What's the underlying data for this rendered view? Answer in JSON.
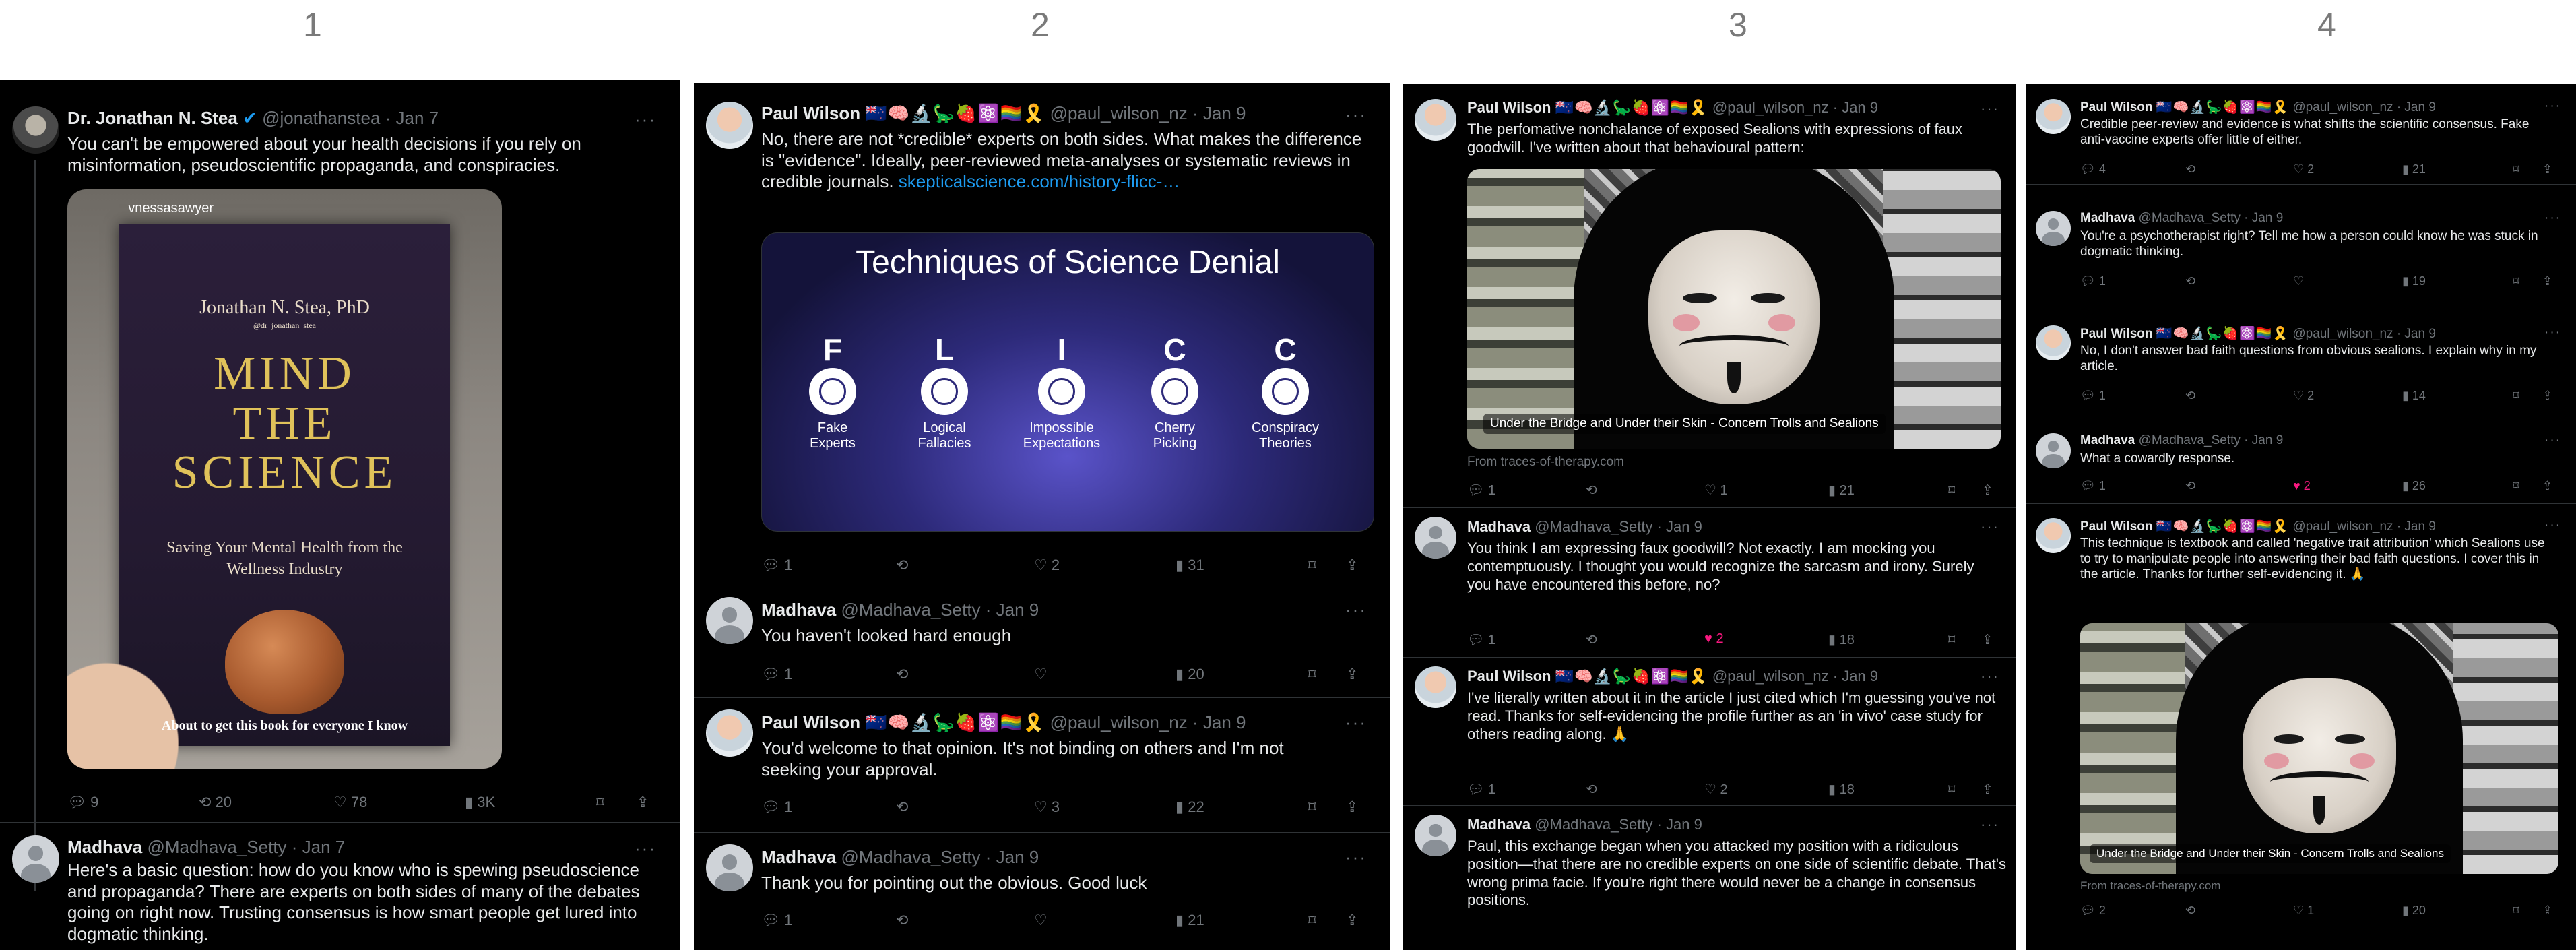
{
  "panel_numbers": [
    "1",
    "2",
    "3",
    "4"
  ],
  "icons": {
    "reply": "reply-icon",
    "retweet": "retweet-icon",
    "like": "heart-icon",
    "views": "views-icon",
    "bookmark": "bookmark-icon",
    "share": "share-icon",
    "more": "more-icon",
    "verified": "verified-icon"
  },
  "colors": {
    "background": "#000000",
    "link": "#1d9bf0",
    "muted": "#71767b",
    "like_active": "#f91880"
  },
  "paul_emojis": "🇳🇿🧠🔬🦕🍓⚛️🏳️‍🌈🎗️",
  "panel1": {
    "tweet1": {
      "name": "Dr. Jonathan N. Stea",
      "handle": "@jonathanstea · Jan 7",
      "text": "You can't be empowered about your health decisions if you rely on misinformation, pseudoscientific propaganda, and conspiracies.",
      "image": {
        "story_user": "vnessasawyer",
        "author": "Jonathan N. Stea, PhD",
        "author_handle": "@dr_jonathan_stea",
        "title_lines": [
          "MIND",
          "THE",
          "SCIENCE"
        ],
        "subtitle": "Saving Your Mental Health from the Wellness Industry",
        "caption": "About to get this book for everyone I know"
      },
      "replies": "9",
      "retweets": "20",
      "likes": "78",
      "views": "3K"
    },
    "tweet2": {
      "name": "Madhava",
      "handle": "@Madhava_Setty · Jan 7",
      "text": "Here's a basic question: how do you know who is spewing pseudoscience and propaganda? There are experts on both sides of many of the debates going on right now. Trusting consensus is how smart people get lured into dogmatic thinking."
    }
  },
  "panel2": {
    "tweet1": {
      "name": "Paul Wilson",
      "handle": "@paul_wilson_nz · Jan 9",
      "text": "No, there are not *credible* experts on both sides. What makes the difference is \"evidence\". Ideally, peer-reviewed meta-analyses or systematic reviews in credible journals.",
      "link": "skepticalscience.com/history-flicc-…",
      "card": {
        "title": "Techniques of Science Denial",
        "letters": [
          "F",
          "L",
          "I",
          "C",
          "C"
        ],
        "labels": [
          "Fake Experts",
          "Logical Fallacies",
          "Impossible Expectations",
          "Cherry Picking",
          "Conspiracy Theories"
        ]
      },
      "replies": "1",
      "retweets": "",
      "likes": "2",
      "views": "31"
    },
    "tweet2": {
      "name": "Madhava",
      "handle": "@Madhava_Setty · Jan 9",
      "text": "You haven't looked hard enough",
      "replies": "1",
      "likes": "",
      "views": "20"
    },
    "tweet3": {
      "name": "Paul Wilson",
      "handle": "@paul_wilson_nz · Jan 9",
      "text": "You'd welcome to that opinion. It's not binding on others and I'm not seeking your approval.",
      "replies": "1",
      "likes": "3",
      "views": "22"
    },
    "tweet4": {
      "name": "Madhava",
      "handle": "@Madhava_Setty · Jan 9",
      "text": "Thank you for pointing out the obvious. Good luck",
      "replies": "1",
      "likes": "",
      "views": "21"
    }
  },
  "panel3": {
    "tweet1": {
      "name": "Paul Wilson",
      "handle": "@paul_wilson_nz · Jan 9",
      "text": "The perfomative nonchalance of exposed Sealions with expressions of faux goodwill. I've written about that behavioural pattern:",
      "image_caption": "Under the Bridge and Under their Skin - Concern Trolls and Sealions",
      "from": "From traces-of-therapy.com",
      "replies": "1",
      "likes": "1",
      "views": "21"
    },
    "tweet2": {
      "name": "Madhava",
      "handle": "@Madhava_Setty · Jan 9",
      "text": "You think I am expressing faux goodwill? Not exactly. I am mocking you contemptuously. I thought you would recognize the sarcasm and irony. Surely you have encountered this before, no?",
      "replies": "1",
      "likes": "2",
      "views": "18"
    },
    "tweet3": {
      "name": "Paul Wilson",
      "handle": "@paul_wilson_nz · Jan 9",
      "text": "I've literally written about it in the article I just cited which I'm guessing you've not read. Thanks for self-evidencing the profile further as an 'in vivo' case study for others reading along. 🙏",
      "replies": "1",
      "likes": "2",
      "views": "18"
    },
    "tweet4": {
      "name": "Madhava",
      "handle": "@Madhava_Setty · Jan 9",
      "text": "Paul, this exchange began when you attacked my position with a ridiculous position—that there are no credible experts on one side of scientific debate. That's wrong prima facie. If you're right there would never be a change in consensus positions."
    }
  },
  "panel4": {
    "tweet1": {
      "name": "Paul Wilson",
      "handle": "@paul_wilson_nz · Jan 9",
      "text": "Credible peer-review and evidence is what shifts the scientific consensus. Fake anti-vaccine experts offer little of either.",
      "replies": "4",
      "likes": "2",
      "views": "21"
    },
    "tweet2": {
      "name": "Madhava",
      "handle": "@Madhava_Setty · Jan 9",
      "text": "You're a psychotherapist right? Tell me how a person could know he was stuck in dogmatic thinking.",
      "replies": "1",
      "likes": "",
      "views": "19"
    },
    "tweet3": {
      "name": "Paul Wilson",
      "handle": "@paul_wilson_nz · Jan 9",
      "text": "No, I don't answer bad faith questions from obvious sealions. I explain why in my article.",
      "replies": "1",
      "likes": "2",
      "views": "14"
    },
    "tweet4": {
      "name": "Madhava",
      "handle": "@Madhava_Setty · Jan 9",
      "text": "What a cowardly response.",
      "replies": "1",
      "likes": "2",
      "views": "26"
    },
    "tweet5": {
      "name": "Paul Wilson",
      "handle": "@paul_wilson_nz · Jan 9",
      "text": "This technique is textbook and called 'negative trait attribution' which Sealions use to try to manipulate people into answering their bad faith questions. I cover this in the article. Thanks for further self-evidencing it. 🙏",
      "image_caption": "Under the Bridge and Under their Skin - Concern Trolls and Sealions",
      "from": "From traces-of-therapy.com",
      "replies": "2",
      "likes": "1",
      "views": "20"
    }
  }
}
